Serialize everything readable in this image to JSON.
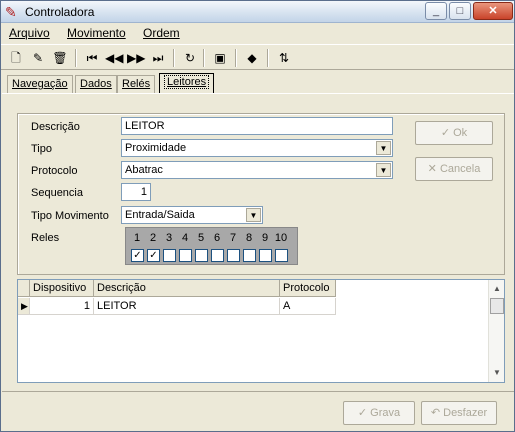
{
  "window": {
    "title": "Controladora"
  },
  "menu": [
    "Arquivo",
    "Movimento",
    "Ordem"
  ],
  "toolbar": [
    "new-icon",
    "edit-icon",
    "delete-icon",
    "first-icon",
    "prev-icon",
    "next-icon",
    "last-icon",
    "refresh-icon",
    "properties-icon",
    "gem-icon",
    "sort-icon"
  ],
  "tabs": [
    "Navegação",
    "Dados",
    "Relés",
    "Leitores"
  ],
  "form": {
    "descricao_label": "Descrição",
    "descricao_value": "LEITOR",
    "tipo_label": "Tipo",
    "tipo_value": "Proximidade",
    "protocolo_label": "Protocolo",
    "protocolo_value": "Abatrac",
    "sequencia_label": "Sequencia",
    "sequencia_value": "1",
    "tipo_mov_label": "Tipo Movimento",
    "tipo_mov_value": "Entrada/Saida",
    "reles_label": "Reles",
    "reles": [
      {
        "n": "1",
        "checked": true
      },
      {
        "n": "2",
        "checked": true
      },
      {
        "n": "3",
        "checked": false
      },
      {
        "n": "4",
        "checked": false
      },
      {
        "n": "5",
        "checked": false
      },
      {
        "n": "6",
        "checked": false
      },
      {
        "n": "7",
        "checked": false
      },
      {
        "n": "8",
        "checked": false
      },
      {
        "n": "9",
        "checked": false
      },
      {
        "n": "10",
        "checked": false
      }
    ]
  },
  "buttons": {
    "ok": "Ok",
    "cancela": "Cancela",
    "grava": "Grava",
    "desfazer": "Desfazer"
  },
  "grid": {
    "headers": [
      "Dispositivo",
      "Descrição",
      "Protocolo"
    ],
    "rows": [
      {
        "dispositivo": "1",
        "descricao": "LEITOR",
        "protocolo": "A"
      }
    ]
  }
}
